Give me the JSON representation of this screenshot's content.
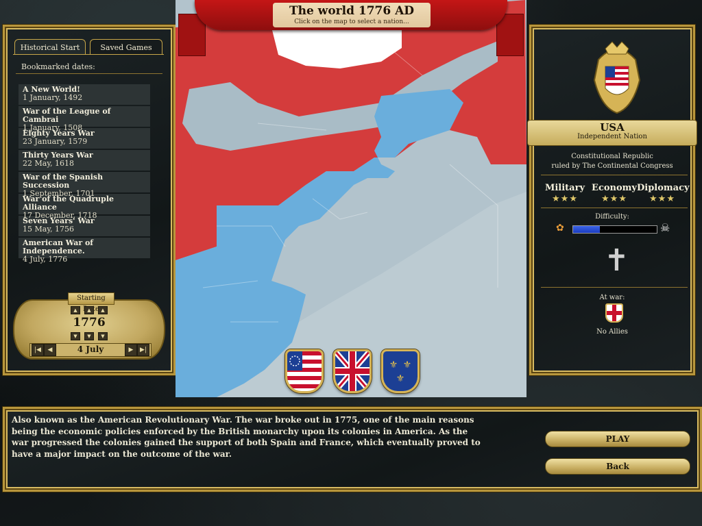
{
  "left_panel": {
    "tabs": [
      {
        "label": "Historical Start",
        "active": true
      },
      {
        "label": "Saved Games",
        "active": false
      }
    ],
    "bookmarked_label": "Bookmarked dates:",
    "dates": [
      {
        "name": "A New World!",
        "date": "1 January, 1492"
      },
      {
        "name": "War of the League of Cambrai",
        "date": "1 January, 1508"
      },
      {
        "name": "Eighty Years War",
        "date": "23 January, 1579"
      },
      {
        "name": "Thirty Years War",
        "date": "22 May, 1618"
      },
      {
        "name": "War of the Spanish Succession",
        "date": "1 September, 1701"
      },
      {
        "name": "War of the Quadruple Alliance",
        "date": "17 December, 1718"
      },
      {
        "name": "Seven Years' War",
        "date": "15 May, 1756"
      },
      {
        "name": "American War of Independence.",
        "date": "4 July, 1776"
      }
    ],
    "starting_date": {
      "title": "Starting Date",
      "year": "1776",
      "day": "4 July"
    }
  },
  "map": {
    "title": "The world 1776 AD",
    "subtitle": "Click on the map to select a nation...",
    "colors": {
      "british": "#d23a3a",
      "usa": "#6aaedc",
      "sea": "#a9bcc6",
      "ice": "#ffffff"
    },
    "shields": [
      {
        "name": "usa-flag-icon"
      },
      {
        "name": "great-britain-flag-icon"
      },
      {
        "name": "france-flag-icon"
      }
    ]
  },
  "right_panel": {
    "nation_name": "USA",
    "nation_type": "Independent Nation",
    "government": "Constitutional Republic",
    "ruler": "ruled by The Continental Congress",
    "stats": {
      "military_label": "Military",
      "military_stars": "★★★",
      "economy_label": "Economy",
      "economy_stars": "★★★",
      "diplomacy_label": "Diplomacy",
      "diplomacy_stars": "★★★"
    },
    "difficulty_label": "Difficulty:",
    "difficulty_level": 0.32,
    "at_war_label": "At war:",
    "allies_label": "No Allies"
  },
  "bottom": {
    "description": "Also known as the American Revolutionary War. The war broke out in 1775, one of the main reasons being the economic policies enforced by the British monarchy upon its colonies in America. As the war progressed the colonies gained the support of both Spain and France, which eventually proved to have a major impact on the outcome of the war.",
    "play_label": "PLAY",
    "back_label": "Back"
  }
}
